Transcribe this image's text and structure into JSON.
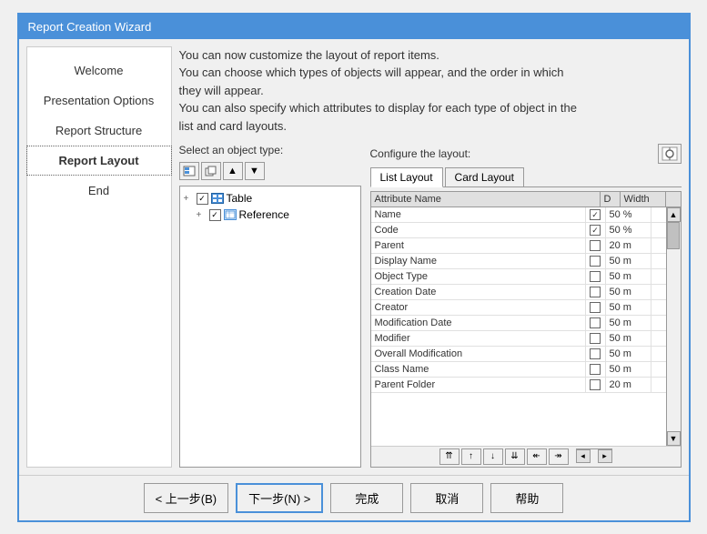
{
  "title": "Report Creation Wizard",
  "sidebar": {
    "items": [
      {
        "label": "Welcome",
        "active": false
      },
      {
        "label": "Presentation Options",
        "active": false
      },
      {
        "label": "Report Structure",
        "active": false
      },
      {
        "label": "Report Layout",
        "active": true
      },
      {
        "label": "End",
        "active": false
      }
    ]
  },
  "description": {
    "line1": "You can now customize the layout of report items.",
    "line2": "You can choose which types of objects will appear, and the order in which",
    "line3": "they will appear.",
    "line4": "You can also specify which attributes to display for each type of object in the",
    "line5": "list and card layouts."
  },
  "left_section_label": "Select an object type:",
  "right_section_label": "Configure the layout:",
  "tree_items": [
    {
      "label": "Table",
      "checked": true,
      "type": "table",
      "expanded": true
    },
    {
      "label": "Reference",
      "checked": true,
      "type": "reference",
      "expanded": true
    }
  ],
  "tabs": [
    {
      "label": "List Layout",
      "active": true
    },
    {
      "label": "Card Layout",
      "active": false
    }
  ],
  "table_header": {
    "name": "Attribute Name",
    "d": "D",
    "width": "Width"
  },
  "attributes": [
    {
      "name": "Name",
      "checked": true,
      "width": "50 %"
    },
    {
      "name": "Code",
      "checked": true,
      "width": "50 %"
    },
    {
      "name": "Parent",
      "checked": false,
      "width": "20 m"
    },
    {
      "name": "Display Name",
      "checked": false,
      "width": "50 m"
    },
    {
      "name": "Object Type",
      "checked": false,
      "width": "50 m"
    },
    {
      "name": "Creation Date",
      "checked": false,
      "width": "50 m"
    },
    {
      "name": "Creator",
      "checked": false,
      "width": "50 m"
    },
    {
      "name": "Modification Date",
      "checked": false,
      "width": "50 m"
    },
    {
      "name": "Modifier",
      "checked": false,
      "width": "50 m"
    },
    {
      "name": "Overall Modification",
      "checked": false,
      "width": "50 m"
    },
    {
      "name": "Class Name",
      "checked": false,
      "width": "50 m"
    },
    {
      "name": "Parent Folder",
      "checked": false,
      "width": "20 m"
    }
  ],
  "footer_buttons": [
    {
      "label": "< 上一步(B)",
      "primary": false
    },
    {
      "label": "下一步(N) >",
      "primary": true
    },
    {
      "label": "完成",
      "primary": false
    },
    {
      "label": "取消",
      "primary": false
    },
    {
      "label": "帮助",
      "primary": false
    }
  ]
}
